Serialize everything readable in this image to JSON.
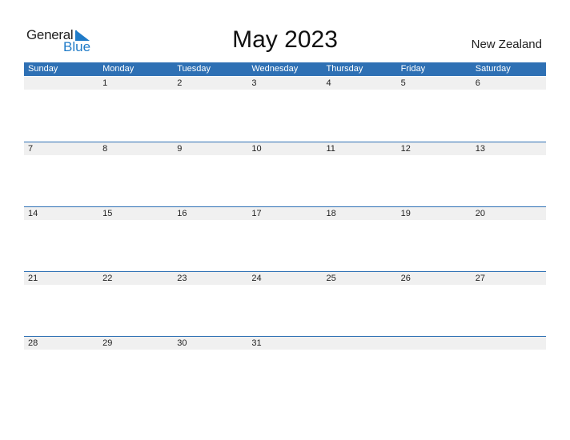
{
  "logo": {
    "line1": "General",
    "line2": "Blue"
  },
  "title": "May 2023",
  "country": "New Zealand",
  "colors": {
    "header": "#2e70b4",
    "date_bar": "#f0f0f0",
    "logo_blue": "#1f7bc8"
  },
  "weekdays": [
    "Sunday",
    "Monday",
    "Tuesday",
    "Wednesday",
    "Thursday",
    "Friday",
    "Saturday"
  ],
  "weeks": [
    [
      "",
      "1",
      "2",
      "3",
      "4",
      "5",
      "6"
    ],
    [
      "7",
      "8",
      "9",
      "10",
      "11",
      "12",
      "13"
    ],
    [
      "14",
      "15",
      "16",
      "17",
      "18",
      "19",
      "20"
    ],
    [
      "21",
      "22",
      "23",
      "24",
      "25",
      "26",
      "27"
    ],
    [
      "28",
      "29",
      "30",
      "31",
      "",
      "",
      ""
    ]
  ]
}
